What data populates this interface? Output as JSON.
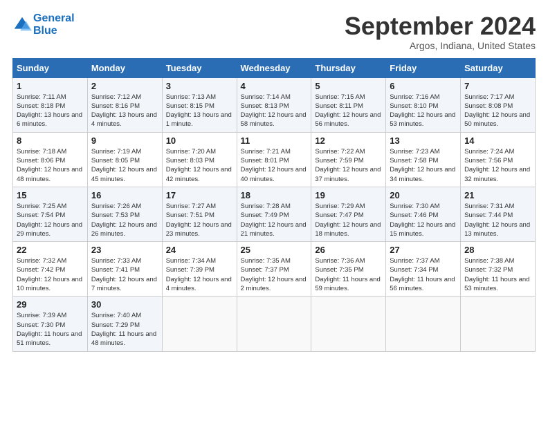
{
  "header": {
    "logo_line1": "General",
    "logo_line2": "Blue",
    "month_title": "September 2024",
    "location": "Argos, Indiana, United States"
  },
  "weekdays": [
    "Sunday",
    "Monday",
    "Tuesday",
    "Wednesday",
    "Thursday",
    "Friday",
    "Saturday"
  ],
  "weeks": [
    [
      {
        "day": "1",
        "sunrise": "Sunrise: 7:11 AM",
        "sunset": "Sunset: 8:18 PM",
        "daylight": "Daylight: 13 hours and 6 minutes."
      },
      {
        "day": "2",
        "sunrise": "Sunrise: 7:12 AM",
        "sunset": "Sunset: 8:16 PM",
        "daylight": "Daylight: 13 hours and 4 minutes."
      },
      {
        "day": "3",
        "sunrise": "Sunrise: 7:13 AM",
        "sunset": "Sunset: 8:15 PM",
        "daylight": "Daylight: 13 hours and 1 minute."
      },
      {
        "day": "4",
        "sunrise": "Sunrise: 7:14 AM",
        "sunset": "Sunset: 8:13 PM",
        "daylight": "Daylight: 12 hours and 58 minutes."
      },
      {
        "day": "5",
        "sunrise": "Sunrise: 7:15 AM",
        "sunset": "Sunset: 8:11 PM",
        "daylight": "Daylight: 12 hours and 56 minutes."
      },
      {
        "day": "6",
        "sunrise": "Sunrise: 7:16 AM",
        "sunset": "Sunset: 8:10 PM",
        "daylight": "Daylight: 12 hours and 53 minutes."
      },
      {
        "day": "7",
        "sunrise": "Sunrise: 7:17 AM",
        "sunset": "Sunset: 8:08 PM",
        "daylight": "Daylight: 12 hours and 50 minutes."
      }
    ],
    [
      {
        "day": "8",
        "sunrise": "Sunrise: 7:18 AM",
        "sunset": "Sunset: 8:06 PM",
        "daylight": "Daylight: 12 hours and 48 minutes."
      },
      {
        "day": "9",
        "sunrise": "Sunrise: 7:19 AM",
        "sunset": "Sunset: 8:05 PM",
        "daylight": "Daylight: 12 hours and 45 minutes."
      },
      {
        "day": "10",
        "sunrise": "Sunrise: 7:20 AM",
        "sunset": "Sunset: 8:03 PM",
        "daylight": "Daylight: 12 hours and 42 minutes."
      },
      {
        "day": "11",
        "sunrise": "Sunrise: 7:21 AM",
        "sunset": "Sunset: 8:01 PM",
        "daylight": "Daylight: 12 hours and 40 minutes."
      },
      {
        "day": "12",
        "sunrise": "Sunrise: 7:22 AM",
        "sunset": "Sunset: 7:59 PM",
        "daylight": "Daylight: 12 hours and 37 minutes."
      },
      {
        "day": "13",
        "sunrise": "Sunrise: 7:23 AM",
        "sunset": "Sunset: 7:58 PM",
        "daylight": "Daylight: 12 hours and 34 minutes."
      },
      {
        "day": "14",
        "sunrise": "Sunrise: 7:24 AM",
        "sunset": "Sunset: 7:56 PM",
        "daylight": "Daylight: 12 hours and 32 minutes."
      }
    ],
    [
      {
        "day": "15",
        "sunrise": "Sunrise: 7:25 AM",
        "sunset": "Sunset: 7:54 PM",
        "daylight": "Daylight: 12 hours and 29 minutes."
      },
      {
        "day": "16",
        "sunrise": "Sunrise: 7:26 AM",
        "sunset": "Sunset: 7:53 PM",
        "daylight": "Daylight: 12 hours and 26 minutes."
      },
      {
        "day": "17",
        "sunrise": "Sunrise: 7:27 AM",
        "sunset": "Sunset: 7:51 PM",
        "daylight": "Daylight: 12 hours and 23 minutes."
      },
      {
        "day": "18",
        "sunrise": "Sunrise: 7:28 AM",
        "sunset": "Sunset: 7:49 PM",
        "daylight": "Daylight: 12 hours and 21 minutes."
      },
      {
        "day": "19",
        "sunrise": "Sunrise: 7:29 AM",
        "sunset": "Sunset: 7:47 PM",
        "daylight": "Daylight: 12 hours and 18 minutes."
      },
      {
        "day": "20",
        "sunrise": "Sunrise: 7:30 AM",
        "sunset": "Sunset: 7:46 PM",
        "daylight": "Daylight: 12 hours and 15 minutes."
      },
      {
        "day": "21",
        "sunrise": "Sunrise: 7:31 AM",
        "sunset": "Sunset: 7:44 PM",
        "daylight": "Daylight: 12 hours and 13 minutes."
      }
    ],
    [
      {
        "day": "22",
        "sunrise": "Sunrise: 7:32 AM",
        "sunset": "Sunset: 7:42 PM",
        "daylight": "Daylight: 12 hours and 10 minutes."
      },
      {
        "day": "23",
        "sunrise": "Sunrise: 7:33 AM",
        "sunset": "Sunset: 7:41 PM",
        "daylight": "Daylight: 12 hours and 7 minutes."
      },
      {
        "day": "24",
        "sunrise": "Sunrise: 7:34 AM",
        "sunset": "Sunset: 7:39 PM",
        "daylight": "Daylight: 12 hours and 4 minutes."
      },
      {
        "day": "25",
        "sunrise": "Sunrise: 7:35 AM",
        "sunset": "Sunset: 7:37 PM",
        "daylight": "Daylight: 12 hours and 2 minutes."
      },
      {
        "day": "26",
        "sunrise": "Sunrise: 7:36 AM",
        "sunset": "Sunset: 7:35 PM",
        "daylight": "Daylight: 11 hours and 59 minutes."
      },
      {
        "day": "27",
        "sunrise": "Sunrise: 7:37 AM",
        "sunset": "Sunset: 7:34 PM",
        "daylight": "Daylight: 11 hours and 56 minutes."
      },
      {
        "day": "28",
        "sunrise": "Sunrise: 7:38 AM",
        "sunset": "Sunset: 7:32 PM",
        "daylight": "Daylight: 11 hours and 53 minutes."
      }
    ],
    [
      {
        "day": "29",
        "sunrise": "Sunrise: 7:39 AM",
        "sunset": "Sunset: 7:30 PM",
        "daylight": "Daylight: 11 hours and 51 minutes."
      },
      {
        "day": "30",
        "sunrise": "Sunrise: 7:40 AM",
        "sunset": "Sunset: 7:29 PM",
        "daylight": "Daylight: 11 hours and 48 minutes."
      },
      null,
      null,
      null,
      null,
      null
    ]
  ]
}
